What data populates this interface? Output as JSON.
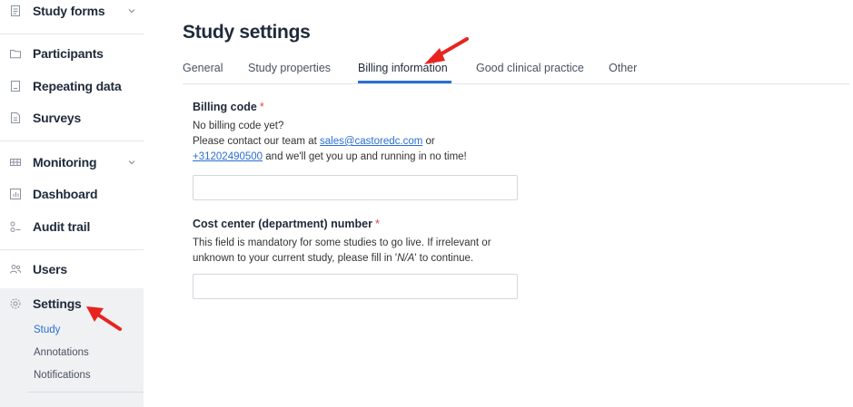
{
  "sidebar": {
    "items": [
      {
        "label": "Study forms",
        "icon": "form-icon",
        "chevron": true
      },
      {
        "label": "Participants",
        "icon": "folder-icon",
        "chevron": false
      },
      {
        "label": "Repeating data",
        "icon": "document-icon",
        "chevron": false
      },
      {
        "label": "Surveys",
        "icon": "survey-icon",
        "chevron": false
      },
      {
        "label": "Monitoring",
        "icon": "monitoring-icon",
        "chevron": true
      },
      {
        "label": "Dashboard",
        "icon": "bar-chart-icon",
        "chevron": false
      },
      {
        "label": "Audit trail",
        "icon": "audit-trail-icon",
        "chevron": false
      },
      {
        "label": "Users",
        "icon": "users-icon",
        "chevron": false
      },
      {
        "label": "Settings",
        "icon": "gear-icon",
        "chevron": false
      }
    ],
    "settings_sub": [
      {
        "label": "Study",
        "active": true
      },
      {
        "label": "Annotations",
        "active": false
      },
      {
        "label": "Notifications",
        "active": false
      }
    ]
  },
  "main": {
    "title": "Study settings",
    "tabs": [
      {
        "label": "General",
        "active": false
      },
      {
        "label": "Study properties",
        "active": false
      },
      {
        "label": "Billing information",
        "active": true
      },
      {
        "label": "Good clinical practice",
        "active": false
      },
      {
        "label": "Other",
        "active": false
      }
    ],
    "billing_code": {
      "label": "Billing code",
      "required_mark": "*",
      "help_line1": "No billing code yet?",
      "help_line2_prefix": "Please contact our team at ",
      "email": "sales@castoredc.com",
      "help_line2_suffix": " or",
      "phone": "+31202490500",
      "help_line3_suffix": " and we'll get you up and running in no time!",
      "value": "",
      "placeholder": ""
    },
    "cost_center": {
      "label": "Cost center (department) number",
      "required_mark": "*",
      "help_line1": "This field is mandatory for some studies to go live. If irrelevant or",
      "help_line2_prefix": "unknown to your current study, please fill in '",
      "help_na": "N/A",
      "help_line2_suffix": "' to continue.",
      "value": "",
      "placeholder": ""
    }
  },
  "colors": {
    "accent": "#2a6fd1",
    "required": "#e0474c",
    "annotation_arrow": "#e8231f",
    "settings_bg": "#f0f1f3"
  }
}
